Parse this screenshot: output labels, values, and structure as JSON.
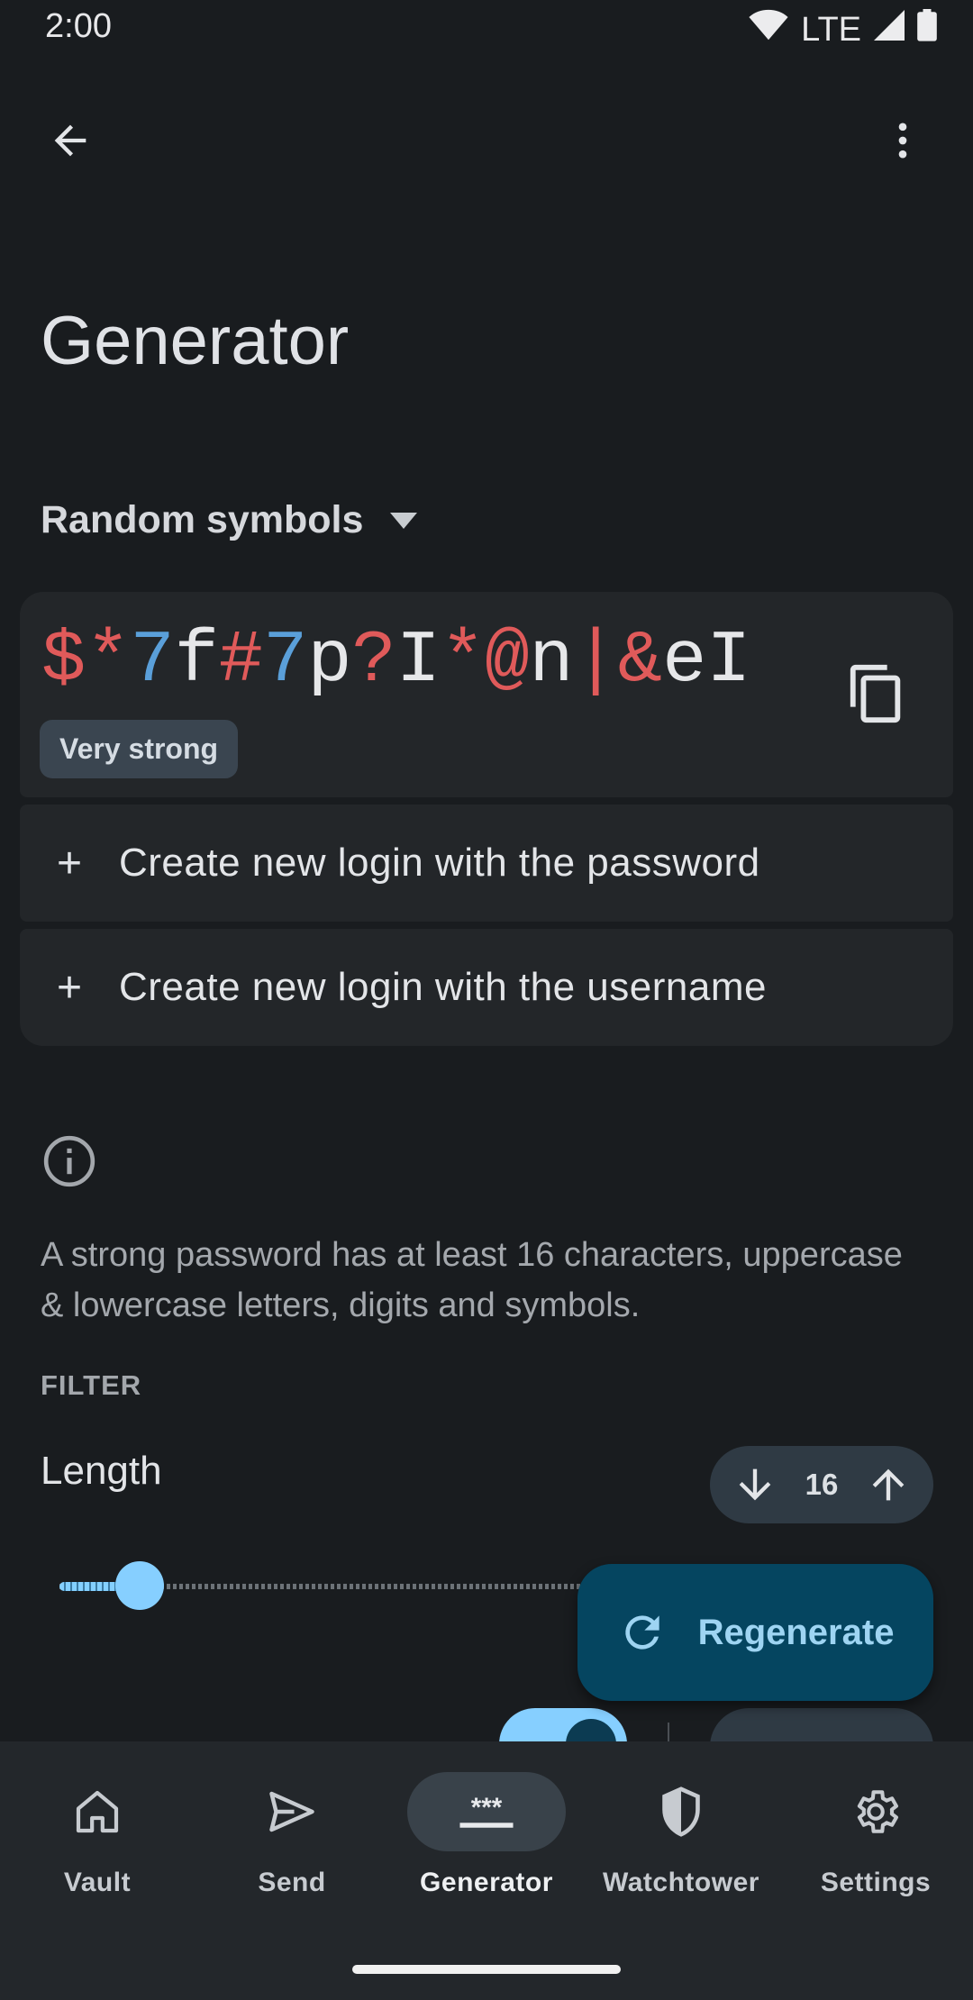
{
  "status_bar": {
    "time": "2:00",
    "network": "LTE"
  },
  "toolbar": {
    "back_icon": "arrow-back-icon",
    "menu_icon": "more-vert-icon"
  },
  "page": {
    "title": "Generator"
  },
  "generator_type": {
    "selected": "Random symbols"
  },
  "password": {
    "chars": [
      {
        "c": "$",
        "t": "symbol"
      },
      {
        "c": "*",
        "t": "symbol"
      },
      {
        "c": "7",
        "t": "digit"
      },
      {
        "c": "f",
        "t": "letter"
      },
      {
        "c": "#",
        "t": "symbol"
      },
      {
        "c": "7",
        "t": "digit"
      },
      {
        "c": "p",
        "t": "letter"
      },
      {
        "c": "?",
        "t": "symbol"
      },
      {
        "c": "I",
        "t": "letter"
      },
      {
        "c": "*",
        "t": "symbol"
      },
      {
        "c": "@",
        "t": "symbol"
      },
      {
        "c": "n",
        "t": "letter"
      },
      {
        "c": "|",
        "t": "symbol"
      },
      {
        "c": "&",
        "t": "symbol"
      },
      {
        "c": "e",
        "t": "letter"
      },
      {
        "c": "I",
        "t": "letter"
      }
    ],
    "strength": "Very strong",
    "colors": {
      "symbol": "#e05a5a",
      "digit": "#5a9fd9",
      "letter": "#e6e7e9"
    }
  },
  "actions": {
    "create_with_password": "Create new login with the password",
    "create_with_username": "Create new login with the username"
  },
  "info": {
    "text": "A strong password has at least 16 characters, uppercase & lowercase letters, digits and symbols."
  },
  "filter": {
    "section_label": "FILTER",
    "length_label": "Length",
    "length_value": "16",
    "slider_level_fraction": 0.09
  },
  "fab": {
    "label": "Regenerate"
  },
  "bottom_nav": {
    "items": [
      {
        "label": "Vault",
        "icon": "home-icon",
        "active": false
      },
      {
        "label": "Send",
        "icon": "send-icon",
        "active": false
      },
      {
        "label": "Generator",
        "icon": "password-icon",
        "active": true
      },
      {
        "label": "Watchtower",
        "icon": "shield-icon",
        "active": false
      },
      {
        "label": "Settings",
        "icon": "gear-icon",
        "active": false
      }
    ]
  },
  "theme": {
    "accent": "#86cfff",
    "fab_bg": "#054560",
    "fab_text": "#9ed4f2"
  }
}
